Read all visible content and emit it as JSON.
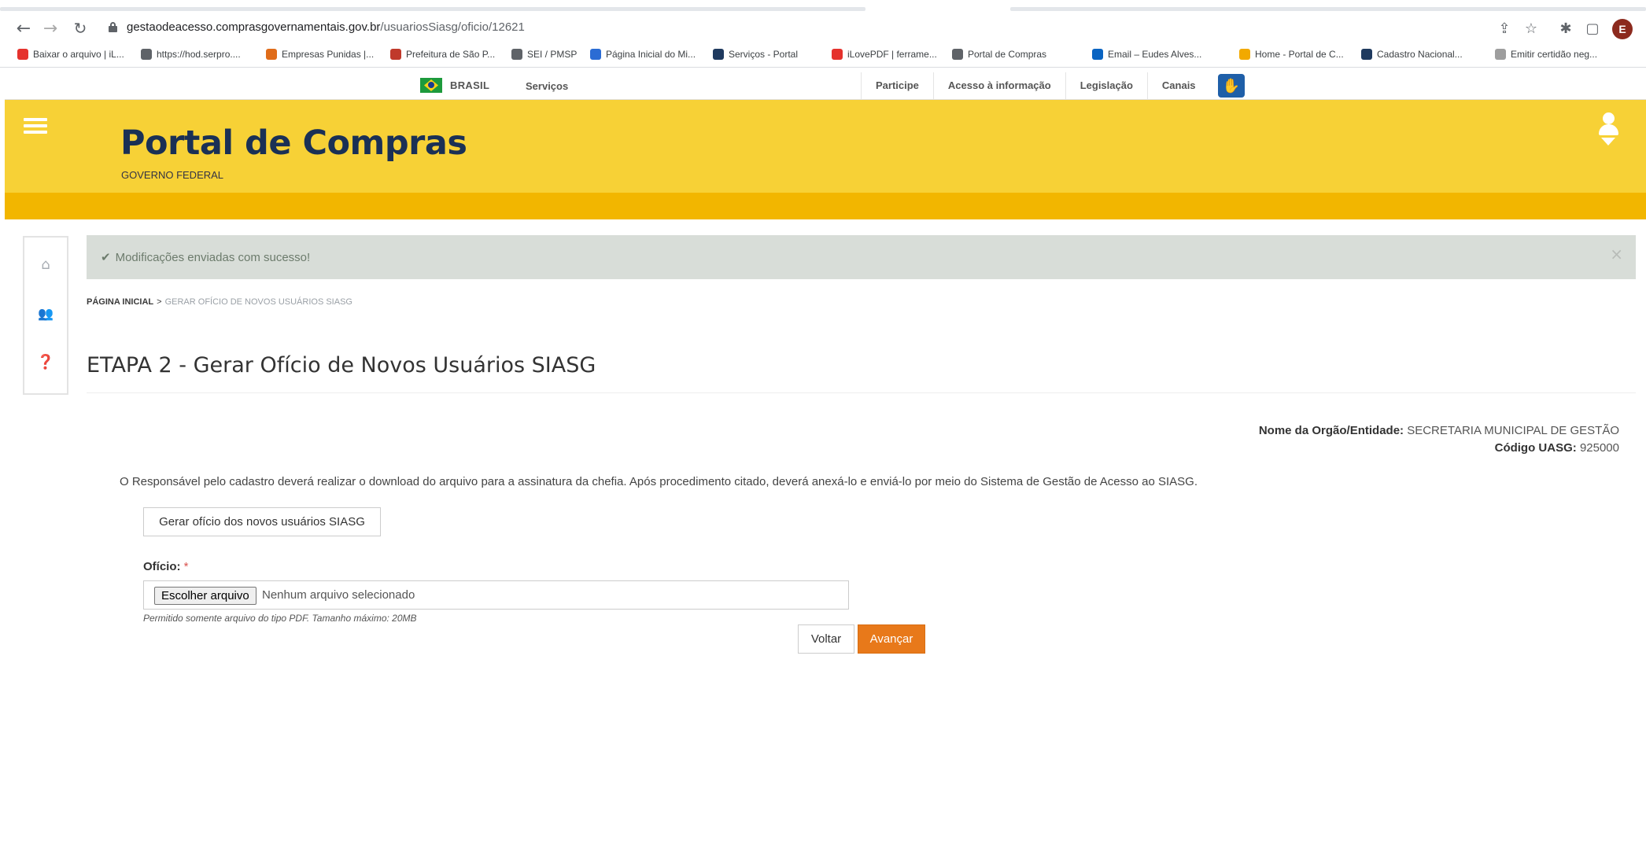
{
  "browser": {
    "url_host": "gestaodeacesso.comprasgovernamentais.gov.br",
    "url_path": "/usuariosSiasg/oficio/12621",
    "profile_initial": "E",
    "bookmarks": [
      {
        "label": "Baixar o arquivo | iL...",
        "color": "#e5322d"
      },
      {
        "label": "https://hod.serpro....",
        "color": "#5f6368"
      },
      {
        "label": "Empresas Punidas |...",
        "color": "#e06c1a"
      },
      {
        "label": "Prefeitura de São P...",
        "color": "#c0392b"
      },
      {
        "label": "SEI / PMSP",
        "color": "#5f6368"
      },
      {
        "label": "Página Inicial do Mi...",
        "color": "#2b6cd4"
      },
      {
        "label": "Serviços - Portal",
        "color": "#1f3a5f"
      },
      {
        "label": "iLovePDF | ferrame...",
        "color": "#e5322d"
      },
      {
        "label": "Portal de Compras",
        "color": "#5f6368"
      },
      {
        "label": "Email – Eudes Alves...",
        "color": "#0a64c2"
      },
      {
        "label": "Home - Portal de C...",
        "color": "#f2a900"
      },
      {
        "label": "Cadastro Nacional...",
        "color": "#1f3a5f"
      },
      {
        "label": "Emitir certidão neg...",
        "color": "#9e9e9e"
      }
    ]
  },
  "govbar": {
    "brasil": "BRASIL",
    "servicos": "Serviços",
    "links": [
      "Participe",
      "Acesso à informação",
      "Legislação",
      "Canais"
    ]
  },
  "header": {
    "title": "Portal de Compras",
    "subtitle": "GOVERNO FEDERAL"
  },
  "alert": {
    "message": "Modificações enviadas com sucesso!",
    "close": "×"
  },
  "breadcrumb": {
    "home": "PÁGINA INICIAL",
    "separator": ">",
    "current": "GERAR OFÍCIO DE NOVOS USUÁRIOS SIASG"
  },
  "page": {
    "title": "ETAPA 2 - Gerar Ofício de Novos Usuários SIASG",
    "org_label": "Nome da Orgão/Entidade:",
    "org_value": "SECRETARIA MUNICIPAL DE GESTÃO",
    "uasg_label": "Código UASG:",
    "uasg_value": "925000",
    "instructions": "O Responsável pelo cadastro deverá realizar o download do arquivo para a assinatura da chefia. Após procedimento citado, deverá anexá-lo e enviá-lo por meio do Sistema de Gestão de Acesso ao SIASG.",
    "generate_button": "Gerar ofício dos novos usuários SIASG",
    "oficio_label": "Ofício:",
    "required_mark": "*",
    "choose_file": "Escolher arquivo",
    "no_file": "Nenhum arquivo selecionado",
    "help": "Permitido somente arquivo do tipo PDF. Tamanho máximo: 20MB",
    "back_button": "Voltar",
    "next_button": "Avançar"
  },
  "colors": {
    "header_yellow": "#f7d136",
    "header_band": "#f2b600",
    "title_navy": "#1a3055",
    "accent_orange": "#e8791a"
  }
}
